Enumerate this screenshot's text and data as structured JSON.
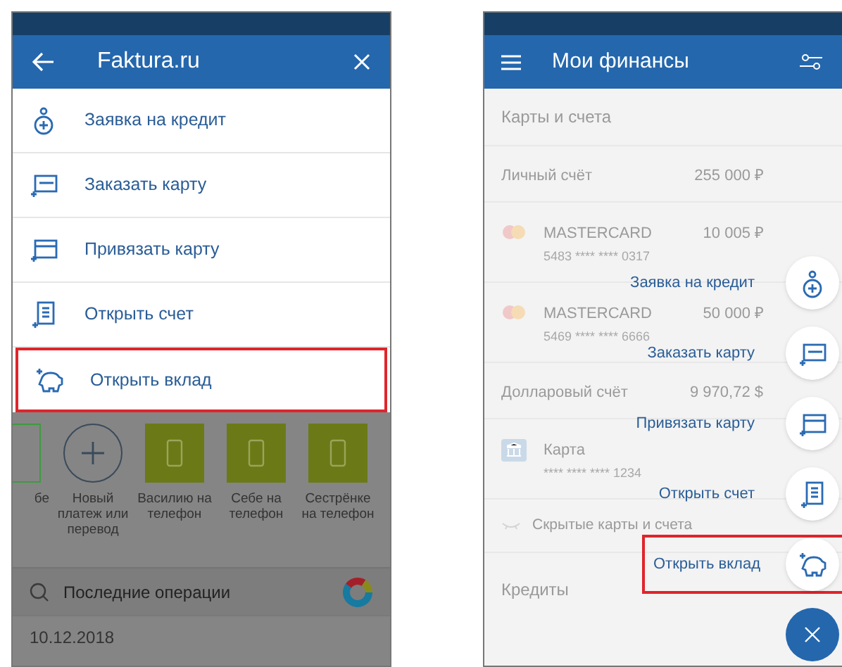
{
  "left_phone": {
    "header": {
      "title": "Faktura.ru"
    },
    "menu": [
      {
        "label": "Заявка на кредит",
        "kind": "loan",
        "selected": false
      },
      {
        "label": "Заказать карту",
        "kind": "order_card",
        "selected": false
      },
      {
        "label": "Привязать карту",
        "kind": "link_card",
        "selected": false
      },
      {
        "label": "Открыть счет",
        "kind": "account",
        "selected": false
      },
      {
        "label": "Открыть вклад",
        "kind": "deposit",
        "selected": true
      }
    ],
    "shortcuts": [
      {
        "label": "бе",
        "kind": "contact"
      },
      {
        "label": "Новый платеж или перевод",
        "kind": "new"
      },
      {
        "label": "Василию на телефон",
        "kind": "phone"
      },
      {
        "label": "Себе на телефон",
        "kind": "phone"
      },
      {
        "label": "Сестрёнке на телефон",
        "kind": "phone"
      }
    ],
    "operations": {
      "title": "Последние операции"
    },
    "date": "10.12.2018"
  },
  "right_phone": {
    "header": {
      "title": "Мои финансы"
    },
    "section": "Карты и счета",
    "accounts": [
      {
        "kind": "account",
        "name": "Личный счёт",
        "amount": "255 000 ₽"
      },
      {
        "kind": "card",
        "name": "MASTERCARD",
        "number": "5483 **** **** 0317",
        "amount": "10 005 ₽"
      },
      {
        "kind": "card",
        "name": "MASTERCARD",
        "number": "5469 **** **** 6666",
        "amount": "50 000 ₽"
      },
      {
        "kind": "account",
        "name": "Долларовый счёт",
        "amount": "9 970,72 $"
      },
      {
        "kind": "bank",
        "name": "Карта",
        "number": "**** **** **** 1234"
      }
    ],
    "hidden": "Скрытые карты и счета",
    "credits": "Кредиты",
    "fab_menu": [
      {
        "label": "Заявка на кредит",
        "kind": "loan",
        "selected": false
      },
      {
        "label": "Заказать карту",
        "kind": "order_card",
        "selected": false
      },
      {
        "label": "Привязать карту",
        "kind": "link_card",
        "selected": false
      },
      {
        "label": "Открыть счет",
        "kind": "account",
        "selected": false
      },
      {
        "label": "Открыть вклад",
        "kind": "deposit",
        "selected": true
      }
    ]
  }
}
